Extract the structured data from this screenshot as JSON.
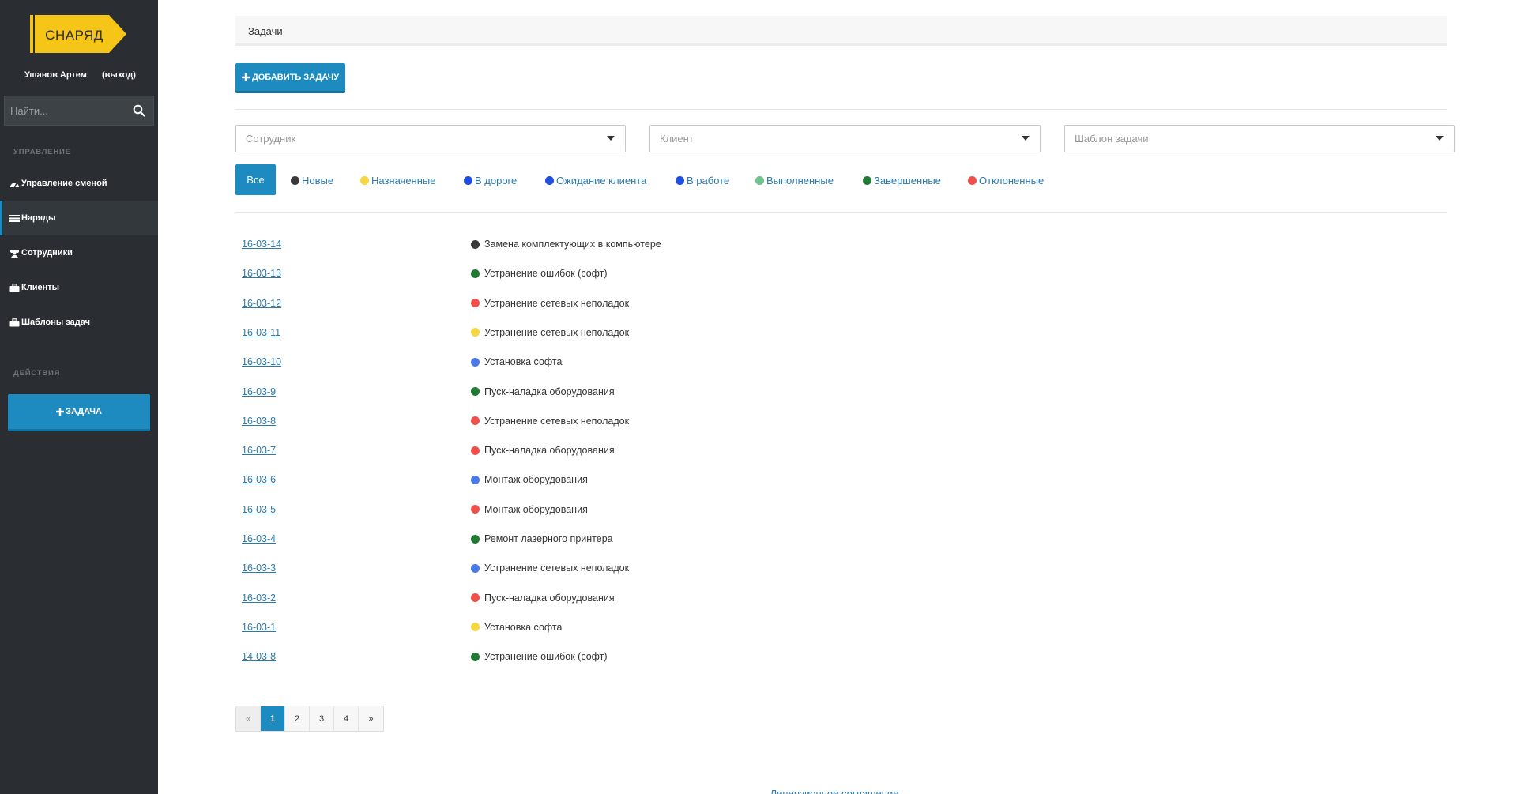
{
  "app": {
    "logo_text": "СНАРЯД",
    "logo_color": "#f5c518"
  },
  "user": {
    "name": "Ушанов Артем",
    "logout": "(выход)"
  },
  "search": {
    "placeholder": "Найти..."
  },
  "sidebar": {
    "section_manage": "УПРАВЛЕНИЕ",
    "items": [
      {
        "label": "Управление сменой",
        "icon": "dashboard-icon"
      },
      {
        "label": "Наряды",
        "icon": "list-icon",
        "active": true
      },
      {
        "label": "Сотрудники",
        "icon": "users-icon"
      },
      {
        "label": "Клиенты",
        "icon": "briefcase-icon"
      },
      {
        "label": "Шаблоны задач",
        "icon": "briefcase-icon"
      }
    ],
    "section_actions": "ДЕЙСТВИЯ",
    "task_button": "ЗАДАЧА"
  },
  "breadcrumb": {
    "title": "Задачи"
  },
  "toolbar": {
    "add_task": "ДОБАВИТЬ ЗАДАЧУ"
  },
  "filters": {
    "employee_placeholder": "Сотрудник",
    "client_placeholder": "Клиент",
    "template_placeholder": "Шаблон задачи"
  },
  "status_filters": {
    "all": "Все",
    "items": [
      {
        "label": "Новые",
        "color": "#3a3a3a"
      },
      {
        "label": "Назначенные",
        "color": "#f5d742"
      },
      {
        "label": "В дороге",
        "color": "#1e4fe0"
      },
      {
        "label": "Ожидание клиента",
        "color": "#1e4fe0"
      },
      {
        "label": "В работе",
        "color": "#1e4fe0"
      },
      {
        "label": "Выполненные",
        "color": "#6fc28b"
      },
      {
        "label": "Завершенные",
        "color": "#217a33"
      },
      {
        "label": "Отклоненные",
        "color": "#f0504a"
      }
    ]
  },
  "tasks": [
    {
      "number": "16-03-14",
      "title": "Замена комплектующих в компьютере",
      "color": "#3a3a3a"
    },
    {
      "number": "16-03-13",
      "title": "Устранение ошибок (софт)",
      "color": "#217a33"
    },
    {
      "number": "16-03-12",
      "title": "Устранение сетевых неполадок",
      "color": "#f0504a"
    },
    {
      "number": "16-03-11",
      "title": "Устранение сетевых неполадок",
      "color": "#f5d742"
    },
    {
      "number": "16-03-10",
      "title": "Установка софта",
      "color": "#4a7ae8"
    },
    {
      "number": "16-03-9",
      "title": "Пуск-наладка оборудования",
      "color": "#217a33"
    },
    {
      "number": "16-03-8",
      "title": "Устранение сетевых неполадок",
      "color": "#f0504a"
    },
    {
      "number": "16-03-7",
      "title": "Пуск-наладка оборудования",
      "color": "#f0504a"
    },
    {
      "number": "16-03-6",
      "title": "Монтаж оборудования",
      "color": "#4a7ae8"
    },
    {
      "number": "16-03-5",
      "title": "Монтаж оборудования",
      "color": "#f0504a"
    },
    {
      "number": "16-03-4",
      "title": "Ремонт лазерного принтера",
      "color": "#217a33"
    },
    {
      "number": "16-03-3",
      "title": "Устранение сетевых неполадок",
      "color": "#4a7ae8"
    },
    {
      "number": "16-03-2",
      "title": "Пуск-наладка оборудования",
      "color": "#f0504a"
    },
    {
      "number": "16-03-1",
      "title": "Установка софта",
      "color": "#f5d742"
    },
    {
      "number": "14-03-8",
      "title": "Устранение ошибок (софт)",
      "color": "#217a33"
    }
  ],
  "pagination": {
    "prev": "«",
    "pages": [
      "1",
      "2",
      "3",
      "4"
    ],
    "current": "1",
    "next": "»"
  },
  "footer": {
    "license": "Лицензионное соглашение"
  }
}
